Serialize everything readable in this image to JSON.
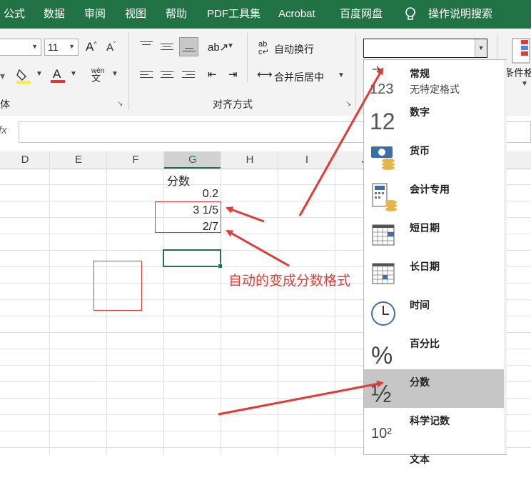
{
  "menu": {
    "items": [
      "公式",
      "数据",
      "审阅",
      "视图",
      "帮助",
      "PDF工具集",
      "Acrobat",
      "百度网盘"
    ],
    "search_label": "操作说明搜索"
  },
  "ribbon": {
    "font_size": "11",
    "font_group_label": "体",
    "wrap_text": "自动换行",
    "merge_center": "合并后居中",
    "align_group_label": "对齐方式",
    "number_format_value": "",
    "conditional_format": "条件格",
    "pinyin_glyph": "wén"
  },
  "formula_bar": {
    "fx": "fx"
  },
  "columns": [
    "D",
    "E",
    "F",
    "G",
    "H",
    "I",
    "J"
  ],
  "cells": {
    "G1": "分数",
    "G2": "0.2",
    "G3": "3 1/5",
    "G4": "2/7"
  },
  "annotation": {
    "text": "自动的变成分数格式",
    "color": "#e53935"
  },
  "number_formats": [
    {
      "label": "常规",
      "sub": "无特定格式",
      "icon": "general-123-icon",
      "glyph": "123"
    },
    {
      "label": "数字",
      "sub": "",
      "icon": "number-12-icon",
      "glyph": "12"
    },
    {
      "label": "货币",
      "sub": "",
      "icon": "currency-icon",
      "glyph": ""
    },
    {
      "label": "会计专用",
      "sub": "",
      "icon": "accounting-icon",
      "glyph": ""
    },
    {
      "label": "短日期",
      "sub": "",
      "icon": "calendar-icon",
      "glyph": ""
    },
    {
      "label": "长日期",
      "sub": "",
      "icon": "calendar-icon",
      "glyph": ""
    },
    {
      "label": "时间",
      "sub": "",
      "icon": "clock-icon",
      "glyph": ""
    },
    {
      "label": "百分比",
      "sub": "",
      "icon": "percent-icon",
      "glyph": "%"
    },
    {
      "label": "分数",
      "sub": "",
      "icon": "fraction-icon",
      "glyph": "½",
      "selected": true
    },
    {
      "label": "科学记数",
      "sub": "",
      "icon": "scientific-icon",
      "glyph": "10²"
    },
    {
      "label": "文本",
      "sub": "",
      "icon": "text-icon",
      "glyph": ""
    }
  ],
  "colors": {
    "excel_green": "#217346",
    "selection_green": "#217346",
    "arrow_red": "#e53935",
    "highlight_gray": "#c6c6c6"
  }
}
